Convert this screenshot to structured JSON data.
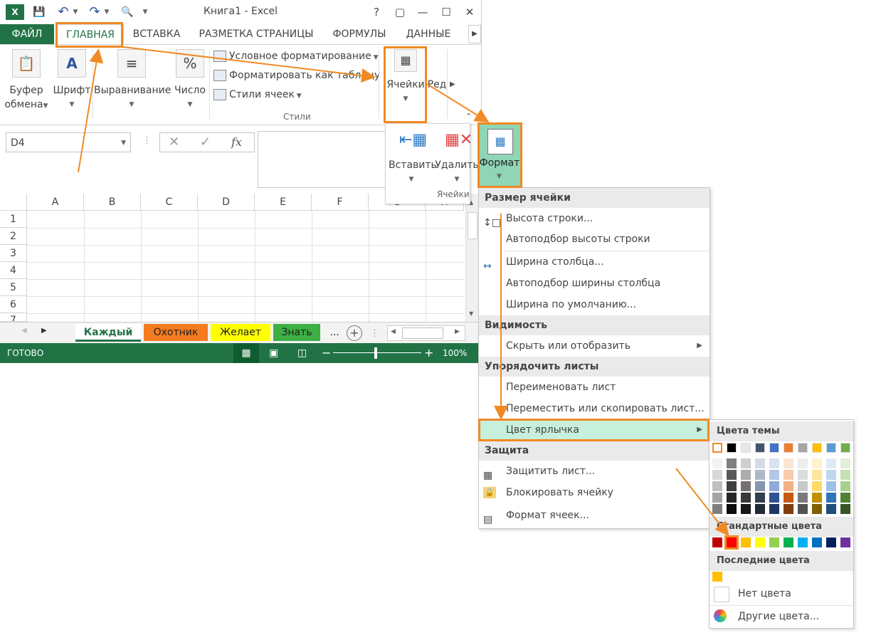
{
  "window": {
    "title": "Книга1 - Excel",
    "buttons": {
      "help": "?",
      "restore": "▢",
      "minimize": "—",
      "maximize": "☐",
      "close": "✕"
    }
  },
  "tabs": [
    "ФАЙЛ",
    "ГЛАВНАЯ",
    "ВСТАВКА",
    "РАЗМЕТКА СТРАНИЦЫ",
    "ФОРМУЛЫ",
    "ДАННЫЕ"
  ],
  "ribbon": {
    "clipboard": {
      "line1": "Буфер",
      "line2": "обмена"
    },
    "font": "Шрифт",
    "alignment": "Выравнивание",
    "number": "Число",
    "styles": {
      "conditional": "Условное форматирование",
      "as_table": "Форматировать как таблицу",
      "cell_styles": "Стили ячеек",
      "group_label": "Стили"
    },
    "cells": "Ячейки",
    "editing": "Ред"
  },
  "formula_bar": {
    "name_box": "D4",
    "fx": "fx"
  },
  "columns": [
    "A",
    "B",
    "C",
    "D",
    "E",
    "F",
    "G",
    "H"
  ],
  "rows": [
    "1",
    "2",
    "3",
    "4",
    "5",
    "6",
    "7"
  ],
  "sheets": [
    {
      "label": "Каждый",
      "color": "#f3f3f3"
    },
    {
      "label": "Охотник",
      "color": "#f47b20"
    },
    {
      "label": "Желает",
      "color": "#ffff00"
    },
    {
      "label": "Знать",
      "color": "#3cb043"
    }
  ],
  "sheet_more": "...",
  "status": {
    "ready": "ГОТОВО",
    "zoom": "100%"
  },
  "cells_popup": {
    "insert": "Вставить",
    "delete": "Удалить",
    "format": "Формат",
    "group_label": "Ячейки"
  },
  "format_menu": {
    "cell_size": "Размер ячейки",
    "row_height": "Высота строки...",
    "autofit_row": "Автоподбор высоты строки",
    "col_width": "Ширина столбца...",
    "autofit_col": "Автоподбор ширины столбца",
    "default_width": "Ширина по умолчанию...",
    "visibility": "Видимость",
    "hide_show": "Скрыть или отобразить",
    "organize": "Упорядочить листы",
    "rename": "Переименовать лист",
    "move_copy": "Переместить или скопировать лист...",
    "tab_color": "Цвет ярлычка",
    "protection": "Защита",
    "protect_sheet": "Защитить лист...",
    "lock_cell": "Блокировать ячейку",
    "format_cells": "Формат ячеек..."
  },
  "color_menu": {
    "theme_colors": "Цвета темы",
    "standard_colors": "Стандартные цвета",
    "recent_colors": "Последние цвета",
    "no_color": "Нет цвета",
    "more_colors": "Другие цвета...",
    "theme_top": [
      "#ffffff",
      "#000000",
      "#e7e6e6",
      "#44546a",
      "#4472c4",
      "#ed7d31",
      "#a5a5a5",
      "#ffc000",
      "#5b9bd5",
      "#70ad47"
    ],
    "theme_shades": [
      [
        "#f2f2f2",
        "#7f7f7f",
        "#d0cece",
        "#d6dce4",
        "#d9e2f3",
        "#fbe5d5",
        "#ededed",
        "#fff2cc",
        "#deebf6",
        "#e2efd9"
      ],
      [
        "#d8d8d8",
        "#595959",
        "#aeabab",
        "#adb9ca",
        "#b4c6e7",
        "#f7cbac",
        "#dbdbdb",
        "#fee599",
        "#bdd7ee",
        "#c5e0b3"
      ],
      [
        "#bfbfbf",
        "#3f3f3f",
        "#757070",
        "#8496b0",
        "#8eaadb",
        "#f4b183",
        "#c9c9c9",
        "#ffd965",
        "#9cc3e5",
        "#a8d08d"
      ],
      [
        "#a5a5a5",
        "#262626",
        "#3a3838",
        "#323f4f",
        "#2f5496",
        "#c55a11",
        "#7b7b7b",
        "#bf9000",
        "#2e75b5",
        "#538135"
      ],
      [
        "#7f7f7f",
        "#0c0c0c",
        "#171616",
        "#222a35",
        "#1e3864",
        "#833c0b",
        "#525252",
        "#7f6000",
        "#1e4e79",
        "#375623"
      ]
    ],
    "standard": [
      "#c00000",
      "#ff0000",
      "#ffc000",
      "#ffff00",
      "#92d050",
      "#00b050",
      "#00b0f0",
      "#0070c0",
      "#002060",
      "#7030a0"
    ],
    "recent": [
      "#ffc000"
    ]
  },
  "accent_colors": {
    "excel_green": "#217346",
    "highlight_orange": "#f08a24",
    "menu_highlight": "#c6efdc"
  }
}
